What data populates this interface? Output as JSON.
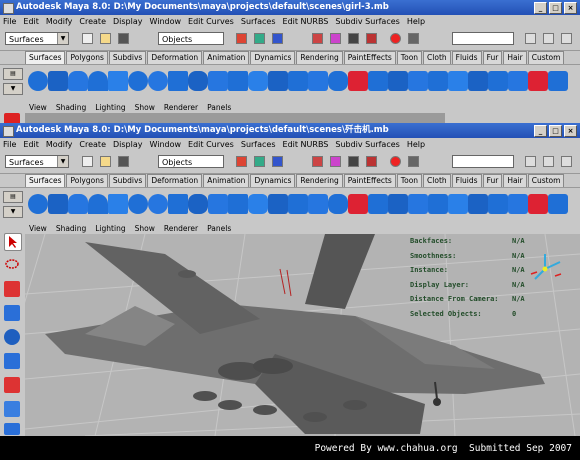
{
  "window_back": {
    "title": "Autodesk Maya 8.0: D:\\My Documents\\maya\\projects\\default\\scenes\\girl-3.mb",
    "controls": {
      "minimize": "_",
      "maximize": "□",
      "close": "×"
    },
    "menus": [
      "File",
      "Edit",
      "Modify",
      "Create",
      "Display",
      "Window",
      "Edit Curves",
      "Surfaces",
      "Edit NURBS",
      "Subdiv Surfaces",
      "Help"
    ],
    "menuset": "Surfaces",
    "objects_field": "Objects",
    "shelf_tabs": [
      "Surfaces",
      "Polygons",
      "Subdivs",
      "Deformation",
      "Animation",
      "Dynamics",
      "Rendering",
      "PaintEffects",
      "Toon",
      "Cloth",
      "Fluids",
      "Fur",
      "Hair",
      "Custom"
    ],
    "panel_menu": [
      "View",
      "Shading",
      "Lighting",
      "Show",
      "Renderer",
      "Panels"
    ]
  },
  "window_front": {
    "title": "Autodesk Maya 8.0: D:\\My Documents\\maya\\projects\\default\\scenes\\歼击机.mb",
    "controls": {
      "minimize": "_",
      "maximize": "□",
      "close": "×"
    },
    "menus": [
      "File",
      "Edit",
      "Modify",
      "Create",
      "Display",
      "Window",
      "Edit Curves",
      "Surfaces",
      "Edit NURBS",
      "Subdiv Surfaces",
      "Help"
    ],
    "menuset": "Surfaces",
    "objects_field": "Objects",
    "shelf_tabs": [
      "Surfaces",
      "Polygons",
      "Subdivs",
      "Deformation",
      "Animation",
      "Dynamics",
      "Rendering",
      "PaintEffects",
      "Toon",
      "Cloth",
      "Fluids",
      "Fur",
      "Hair",
      "Custom"
    ],
    "active_tab": "Surfaces",
    "panel_menu": [
      "View",
      "Shading",
      "Lighting",
      "Show",
      "Renderer",
      "Panels"
    ],
    "hud": [
      {
        "label": "Backfaces:",
        "value": "N/A"
      },
      {
        "label": "Smoothness:",
        "value": "N/A"
      },
      {
        "label": "Instance:",
        "value": "N/A"
      },
      {
        "label": "Display Layer:",
        "value": "N/A"
      },
      {
        "label": "Distance From Camera:",
        "value": "N/A"
      },
      {
        "label": "Selected Objects:",
        "value": "0"
      }
    ]
  },
  "footer": {
    "text": "Powered By www.chahua.org  Submitted Sep 2007"
  },
  "colors": {
    "title_bar": "#2a5cc3",
    "ui_gray": "#c8c8c8",
    "viewport": "#b3b3b3",
    "hud_text": "#234d2a",
    "shelf_blue": "#1f6fd6"
  }
}
